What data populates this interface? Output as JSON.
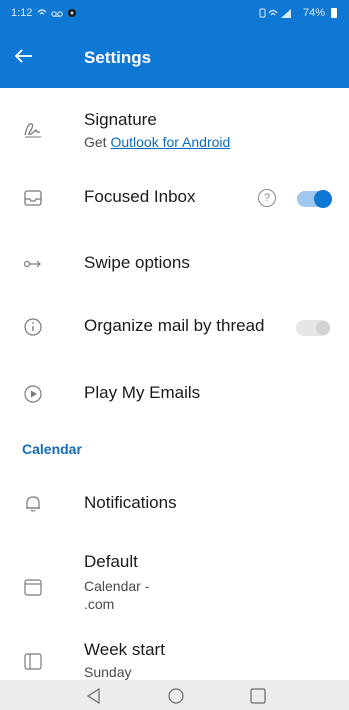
{
  "status_bar": {
    "time": "1:12",
    "battery": "74%"
  },
  "app_bar": {
    "title": "Settings"
  },
  "settings": {
    "signature": {
      "label": "Signature",
      "sub_prefix": "Get ",
      "link": "Outlook for Android"
    },
    "focused_inbox": {
      "label": "Focused Inbox",
      "help": "?",
      "enabled": true
    },
    "swipe_options": {
      "label": "Swipe options"
    },
    "organize_by_thread": {
      "label": "Organize mail by thread",
      "enabled": false
    },
    "play_my_emails": {
      "label": "Play My Emails"
    }
  },
  "calendar": {
    "section_title": "Calendar",
    "notifications": {
      "label": "Notifications"
    },
    "default": {
      "label": "Default",
      "value_line1": "Calendar -",
      "value_line2": ".com"
    },
    "week_start": {
      "label": "Week start",
      "value": "Sunday"
    }
  },
  "icons": {
    "back": "arrow-left-icon",
    "signature": "pen-signature-icon",
    "focused_inbox": "inbox-tray-icon",
    "swipe": "swipe-arrow-icon",
    "thread": "info-circle-icon",
    "play": "play-circle-icon",
    "notifications": "bell-icon",
    "default_calendar": "calendar-icon",
    "week_start": "week-panel-icon"
  },
  "colors": {
    "brand": "#0f78d4",
    "link": "#0f6cbd",
    "toggle_track_on": "#9fc7ef"
  }
}
